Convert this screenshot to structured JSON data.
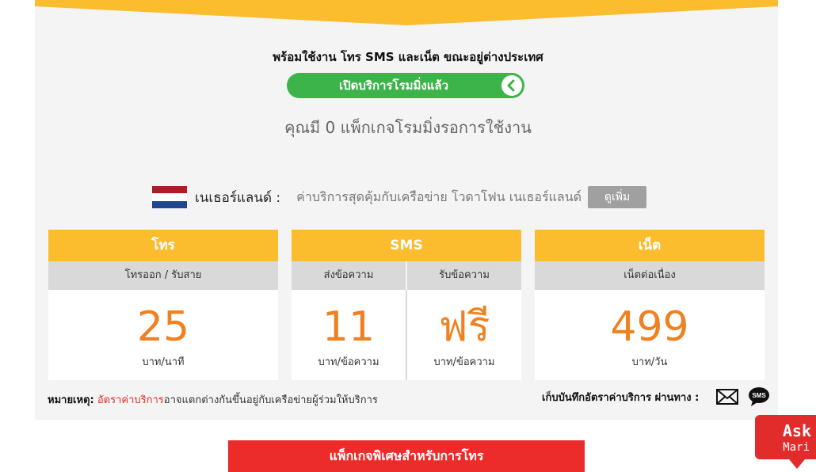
{
  "colors": {
    "accent": "#fbbd2e",
    "green": "#3cb44a",
    "orange": "#ef8120",
    "red": "#ec2b2b"
  },
  "header": {
    "headline": "พร้อมใช้งาน โทร SMS และเน็ต ขณะอยู่ต่างประเทศ"
  },
  "roaming": {
    "button_label": "เปิดบริการโรมมิ่งแล้ว",
    "button_icon": "chevron-left-icon",
    "package_count": "คุณมี 0 แพ็กเกจโรมมิ่งรอการใช้งาน"
  },
  "country": {
    "name": "เนเธอร์แลนด์ :",
    "description": "ค่าบริการสุดคุ้มกับเครือข่าย โวดาโฟน เนเธอร์แลนด์",
    "more_label": "ดูเพิ่ม",
    "flag_colors": [
      "#ae1c28",
      "#ffffff",
      "#21468b"
    ]
  },
  "rates": [
    {
      "title": "โทร",
      "subs": [
        "โทรออก / รับสาย"
      ],
      "values": [
        {
          "value": "25",
          "unit": "บาท/นาที"
        }
      ]
    },
    {
      "title": "SMS",
      "subs": [
        "ส่งข้อความ",
        "รับข้อความ"
      ],
      "values": [
        {
          "value": "11",
          "unit": "บาท/ข้อความ"
        },
        {
          "value": "ฟรี",
          "unit": "บาท/ข้อความ"
        }
      ]
    },
    {
      "title": "เน็ต",
      "subs": [
        "เน็ตต่อเนื่อง"
      ],
      "values": [
        {
          "value": "499",
          "unit": "บาท/วัน"
        }
      ]
    }
  ],
  "note": {
    "label": "หมายเหตุ:",
    "link": "อัตราค่าบริการ",
    "text": "อาจแตกต่างกันขึ้นอยู่กับเครือข่ายผู้ร่วมให้บริการ"
  },
  "save": {
    "label": "เก็บบันทึกอัตราค่าบริการ ผ่านทาง :",
    "icons": [
      "mail-icon",
      "sms-icon"
    ],
    "sms_text": "SMS"
  },
  "special_package": "แพ็กเกจพิเศษสำหรับการโทร",
  "ask_mari": {
    "line1": "Ask",
    "line2": "Mari"
  }
}
